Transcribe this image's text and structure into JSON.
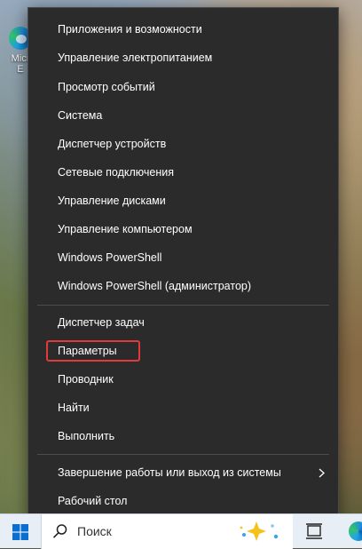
{
  "desktop": {
    "icon_label_line1": "Micr",
    "icon_label_line2": "E"
  },
  "context_menu": {
    "items": [
      {
        "label": "Приложения и возможности"
      },
      {
        "label": "Управление электропитанием"
      },
      {
        "label": "Просмотр событий"
      },
      {
        "label": "Система"
      },
      {
        "label": "Диспетчер устройств"
      },
      {
        "label": "Сетевые подключения"
      },
      {
        "label": "Управление дисками"
      },
      {
        "label": "Управление компьютером"
      },
      {
        "label": "Windows PowerShell"
      },
      {
        "label": "Windows PowerShell (администратор)"
      },
      {
        "label": "Диспетчер задач"
      },
      {
        "label": "Параметры"
      },
      {
        "label": "Проводник"
      },
      {
        "label": "Найти"
      },
      {
        "label": "Выполнить"
      },
      {
        "label": "Завершение работы или выход из системы"
      },
      {
        "label": "Рабочий стол"
      }
    ],
    "highlighted_item": "Параметры",
    "highlight_color": "#e03a3a"
  },
  "taskbar": {
    "search_placeholder": "Поиск"
  },
  "colors": {
    "menu_background": "#2b2b2b",
    "menu_text": "#ffffff",
    "taskbar_background": "#e8eef6",
    "start_blue": "#0a6ed1"
  }
}
